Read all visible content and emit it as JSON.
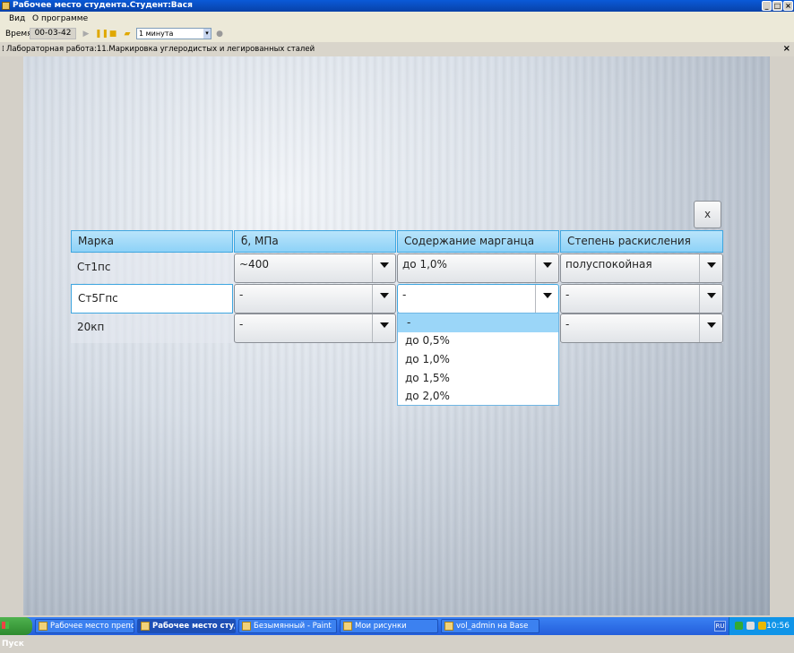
{
  "window": {
    "title": "Рабочее место студента.Студент:Вася"
  },
  "menu": {
    "items": [
      "Вид",
      "О программе"
    ]
  },
  "toolbar": {
    "time_label": "Время",
    "timer": "00-03-42",
    "interval": "1 минута"
  },
  "lab": {
    "title": "Лабораторная работа:11.Маркировка углеродистых и легированных сталей",
    "close": "×"
  },
  "dialog": {
    "close_label": "x"
  },
  "table": {
    "headers": [
      "Марка",
      "б, МПа",
      "Содержание марганца",
      "Степень раскисления"
    ],
    "rows": [
      {
        "grade": "Ст1пс",
        "strength": "~400",
        "manganese": "до 1,0%",
        "deoxidation": "полуспокойная"
      },
      {
        "grade": "Ст5Гпс",
        "strength": "-",
        "manganese": "-",
        "deoxidation": "-"
      },
      {
        "grade": "20кп",
        "strength": "-",
        "manganese": "",
        "deoxidation": "-"
      }
    ]
  },
  "dropdown_open": {
    "options": [
      "-",
      "до 0,5%",
      "до 1,0%",
      "до 1,5%",
      "до 2,0%"
    ],
    "highlighted": "-"
  },
  "taskbar": {
    "start": "Пуск",
    "items": [
      "Рабочее место препода...",
      "Рабочее место студ...",
      "Безымянный - Paint",
      "Мои рисунки",
      "vol_admin на Base"
    ],
    "lang": "RU",
    "clock": "10:56"
  }
}
